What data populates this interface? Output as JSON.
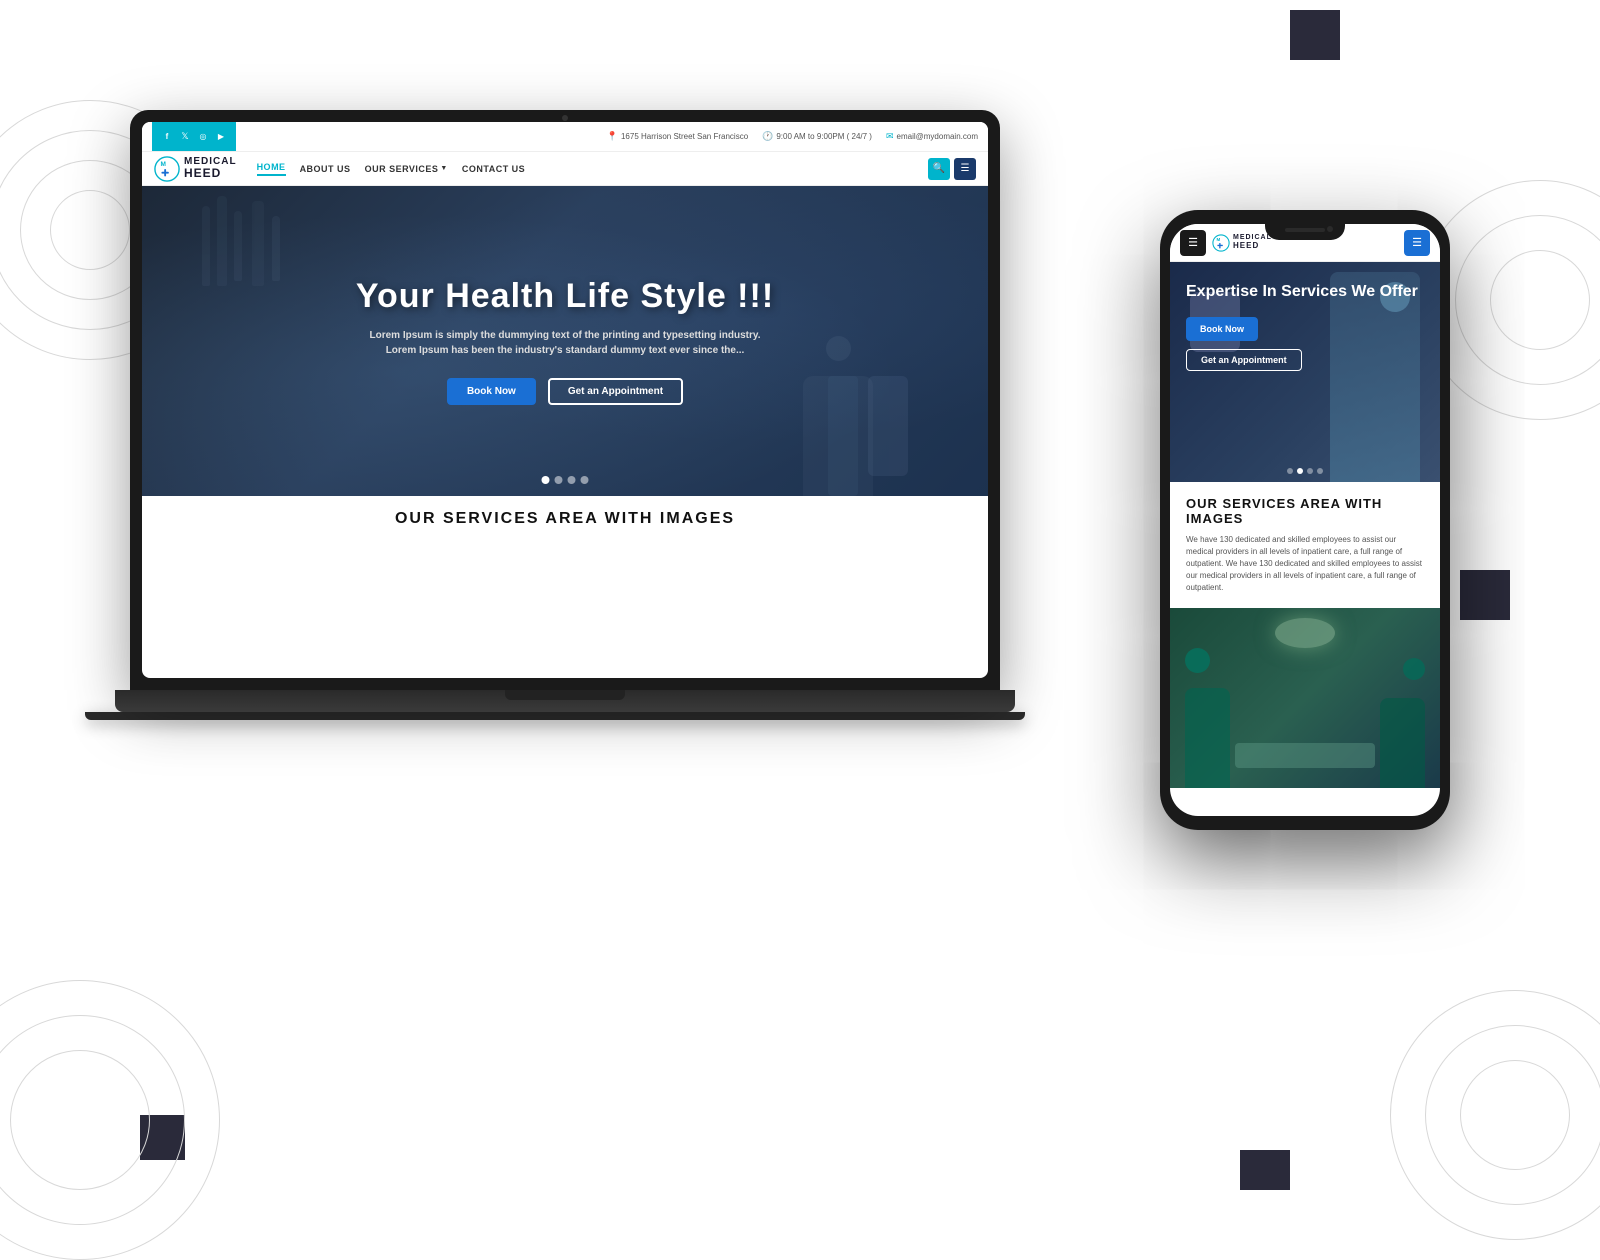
{
  "background": {
    "color": "#ffffff"
  },
  "decorative_squares": [
    {
      "class": "sq1",
      "color": "#2a2a3a"
    },
    {
      "class": "sq2",
      "color": "#2a2a3a"
    },
    {
      "class": "sq3",
      "color": "#2a2a3a"
    },
    {
      "class": "sq4",
      "color": "#2a2a3a"
    }
  ],
  "laptop": {
    "topbar": {
      "social_icons": [
        "f",
        "t",
        "ig",
        "yt"
      ],
      "address": "1675 Harrison Street San Francisco",
      "address_icon": "📍",
      "hours": "9:00 AM to 9:00PM ( 24/7 )",
      "hours_icon": "🕐",
      "email": "email@mydomain.com",
      "email_icon": "✉"
    },
    "navbar": {
      "logo_text_top": "MEDICAL",
      "logo_text_bottom": "HEED",
      "nav_links": [
        {
          "label": "HOME",
          "active": true
        },
        {
          "label": "ABOUT US",
          "active": false
        },
        {
          "label": "OUR SERVICES",
          "active": false,
          "dropdown": true
        },
        {
          "label": "CONTACT US",
          "active": false
        }
      ],
      "search_label": "🔍",
      "menu_label": "☰"
    },
    "hero": {
      "title": "Your Health Life Style !!!",
      "subtitle": "Lorem Ipsum is simply the dummying text of the printing and typesetting industry. Lorem Ipsum has been the industry's standard dummy text ever since the...",
      "book_now_label": "Book Now",
      "get_appointment_label": "Get an Appointment",
      "dots_count": 4,
      "active_dot": 0
    },
    "services": {
      "title": "OUR SERVICES AREA WITH IMAGES"
    }
  },
  "phone": {
    "navbar": {
      "menu_icon": "☰",
      "logo_text_top": "MEDICAL",
      "logo_text_bottom": "HEED",
      "menu_right_icon": "☰"
    },
    "hero": {
      "title": "Expertise In Services We Offer",
      "book_now_label": "Book Now",
      "get_appointment_label": "Get an Appointment",
      "dots_count": 4,
      "active_dot": 1
    },
    "services": {
      "title": "OUR SERVICES AREA WITH IMAGES",
      "description": "We have 130 dedicated and skilled employees to assist our medical providers in all levels of inpatient care, a full range of outpatient. We have 130 dedicated and skilled employees to assist our medical providers in all levels of inpatient care, a full range of outpatient."
    }
  }
}
